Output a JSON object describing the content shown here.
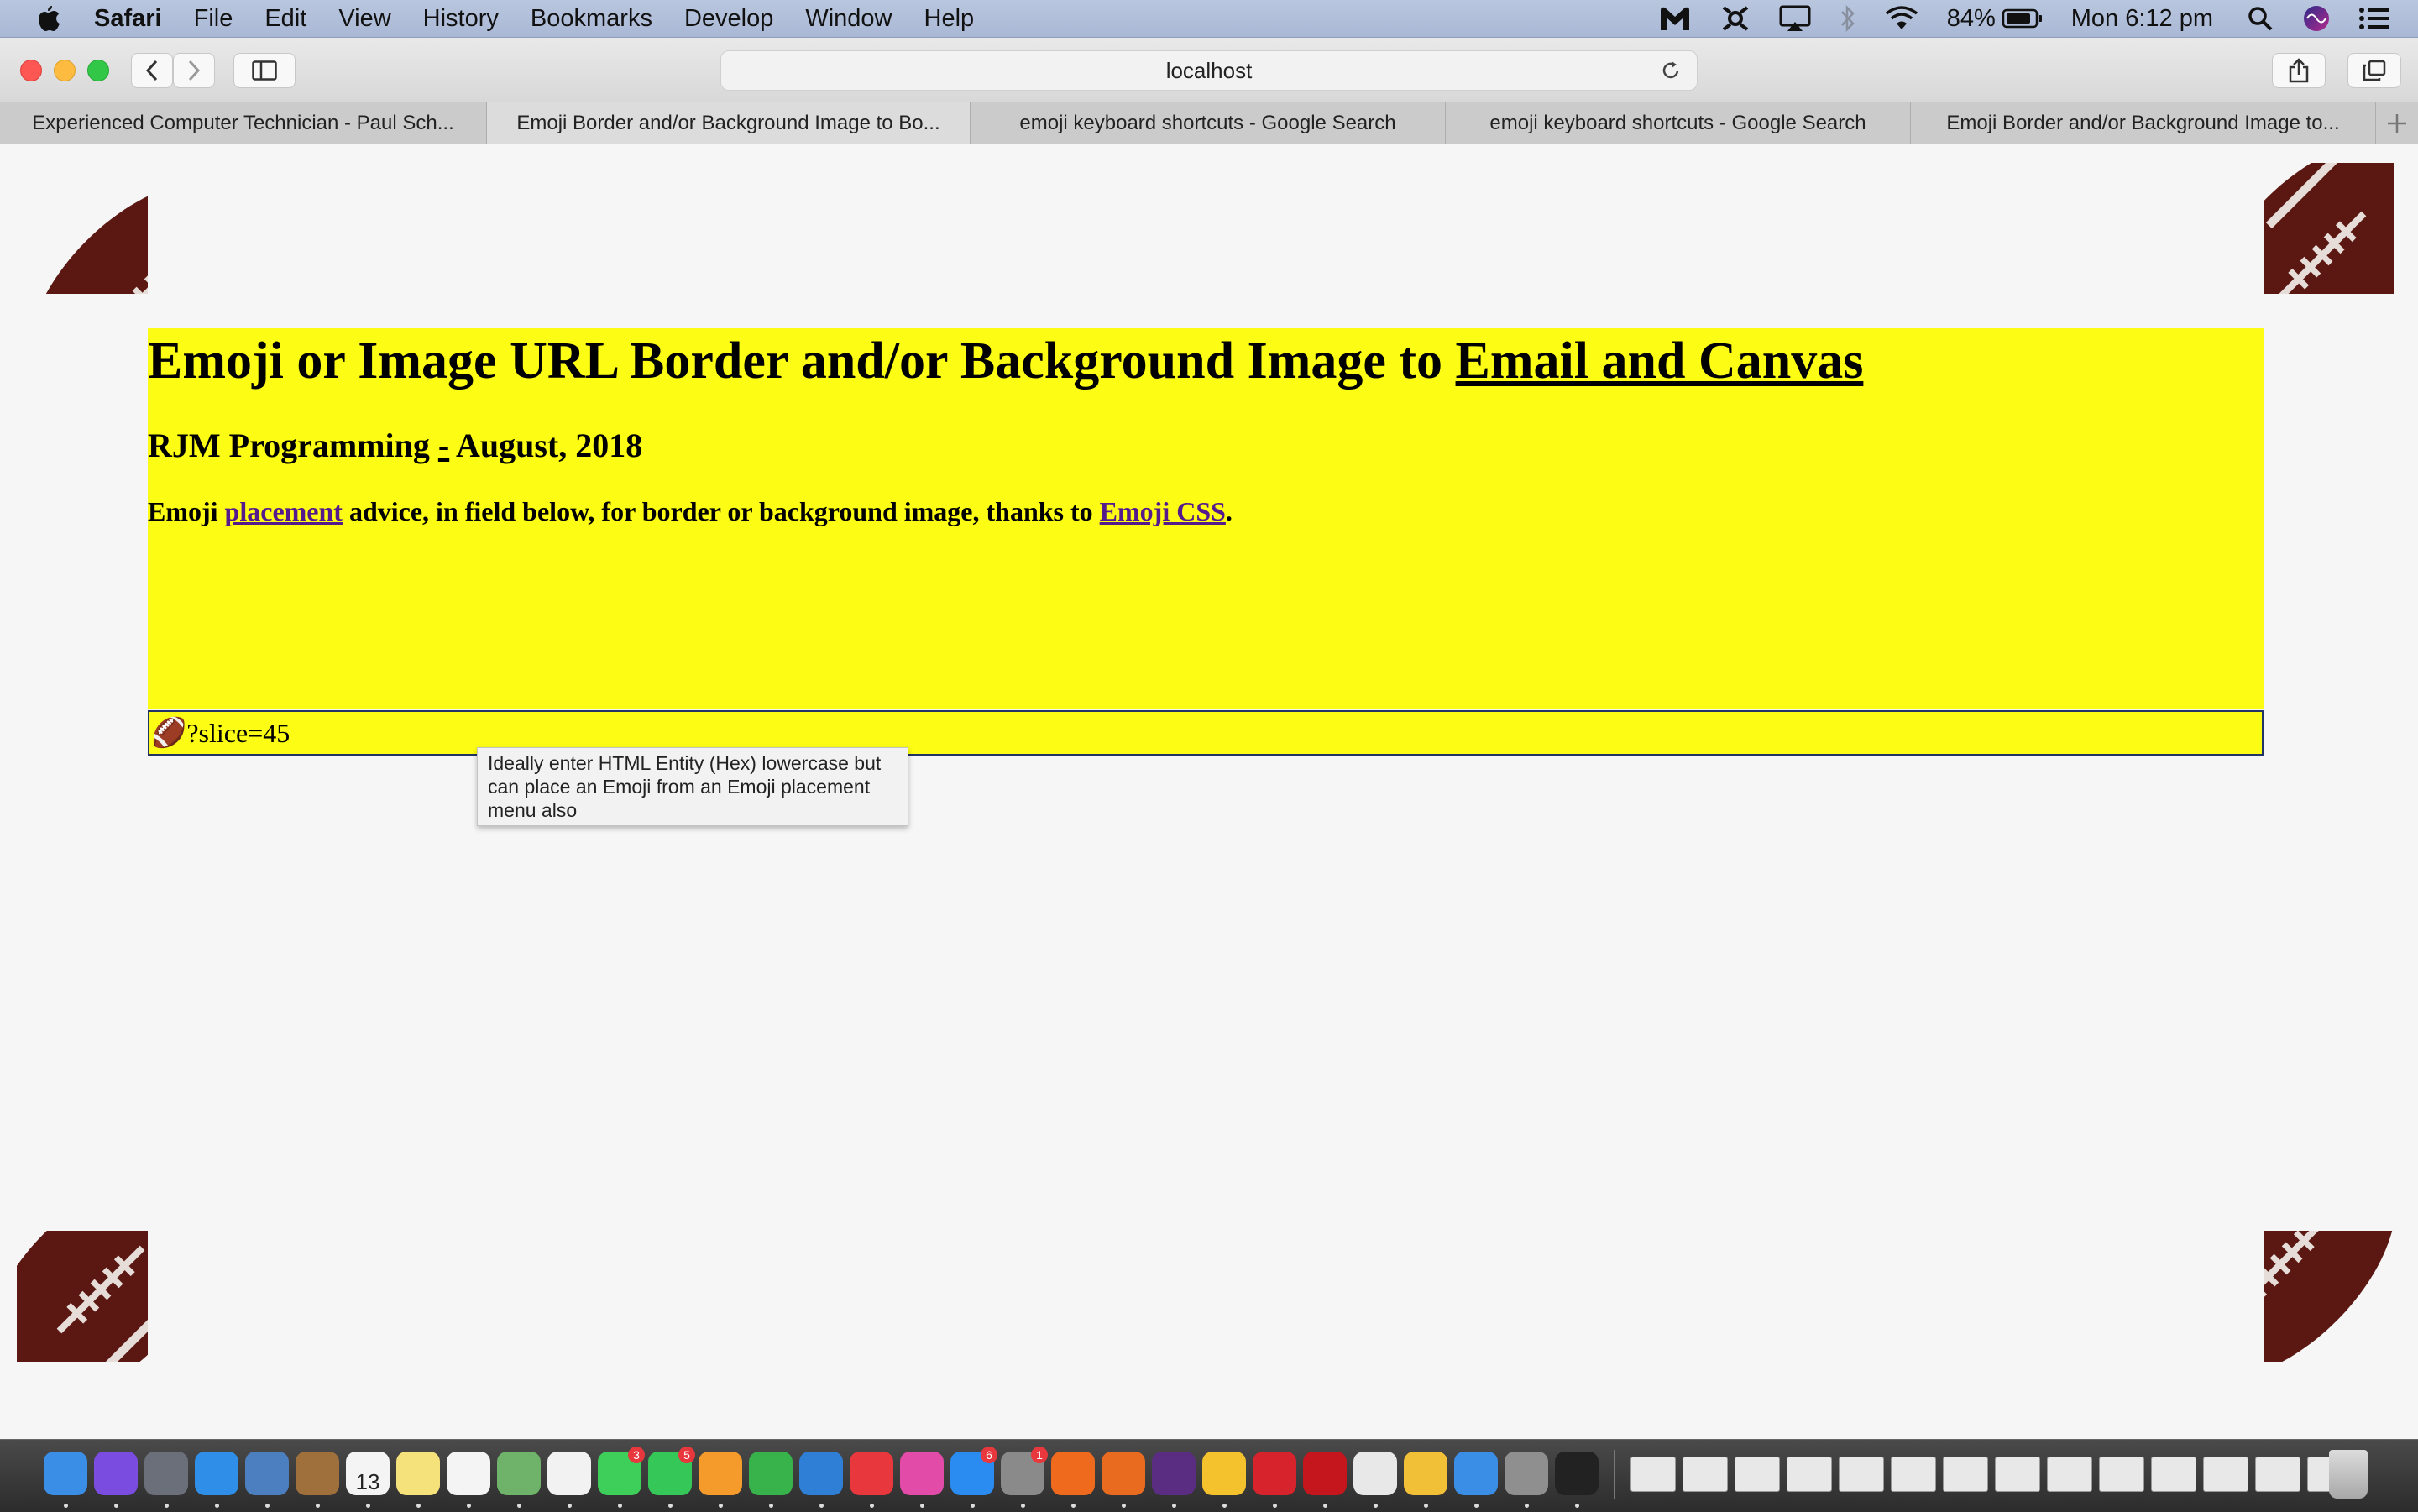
{
  "menubar": {
    "app_name": "Safari",
    "items": [
      "File",
      "Edit",
      "View",
      "History",
      "Bookmarks",
      "Develop",
      "Window",
      "Help"
    ],
    "battery": "84%",
    "clock": "Mon 6:12 pm"
  },
  "toolbar": {
    "url": "localhost"
  },
  "tabs": [
    {
      "label": "Experienced Computer Technician - Paul Sch..."
    },
    {
      "label": "Emoji Border and/or Background Image to Bo..."
    },
    {
      "label": "emoji keyboard shortcuts - Google Search"
    },
    {
      "label": "emoji keyboard shortcuts - Google Search"
    },
    {
      "label": "Emoji Border and/or Background Image to..."
    }
  ],
  "page": {
    "title_text": "Emoji or Image URL Border and/or Background Image to ",
    "title_link": "Email and Canvas",
    "subtitle_name": "RJM Programming ",
    "subtitle_dash": "-",
    "subtitle_date": " August, 2018",
    "advice_prefix": "Emoji ",
    "advice_link1": "placement",
    "advice_middle": " advice, in field below, for border or background image, thanks to ",
    "advice_link2": "Emoji CSS",
    "advice_suffix": ".",
    "field_emoji": "🏈",
    "field_value": "?slice=45",
    "tooltip": "Ideally enter HTML Entity (Hex) lowercase but can place an Emoji from an Emoji placement menu also"
  },
  "colors": {
    "panel_yellow": "#fcfc15",
    "football": "#5b1812",
    "link_visited": "#551a8b"
  },
  "dock": {
    "icons": [
      "finder-icon",
      "siri-icon",
      "launchpad-icon",
      "safari-icon",
      "preview-icon",
      "contacts-icon",
      "calendar-icon",
      "notes-icon",
      "reminders-icon",
      "maps-icon",
      "photos-icon",
      "messages-icon",
      "facetime-icon",
      "pages-icon",
      "numbers-icon",
      "keynote-icon",
      "news-icon",
      "itunes-icon",
      "app-store-icon",
      "system-preferences-icon",
      "avast-icon",
      "firefox-icon",
      "phpstorm-icon",
      "chrome-icon",
      "opera-icon",
      "filezilla-icon",
      "tableplus-icon",
      "mamp-icon",
      "xcode-icon",
      "automator-icon",
      "terminal-icon"
    ],
    "calendar_day": "13",
    "badge_messages": "3",
    "badge_facetime": "5",
    "badge_app_store": "6",
    "badge_system_preferences": "1"
  }
}
